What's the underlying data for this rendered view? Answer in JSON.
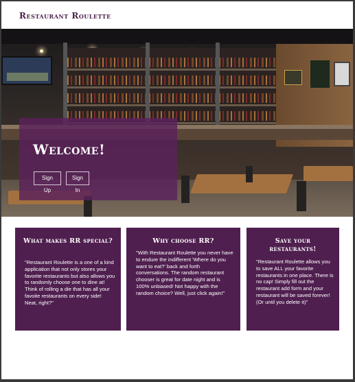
{
  "navbar": {
    "brand": "Restaurant Roulette"
  },
  "hero": {
    "welcome_title": "Welcome!",
    "signup_label": "Sign Up",
    "signin_label": "Sign In"
  },
  "cards": [
    {
      "title": "What makes RR special?",
      "body": "\"Restaurant Roulette is a one of a kind application that not only stores your favorite restaurants but also allows you to randomly choose one to dine at! Think of rolling a die that has all your favoite restaurants on every side! Neat, right?\""
    },
    {
      "title": "Why choose RR?",
      "body": "\"With Restaurant Roulette you never have to endure the indifferent 'Where do you want to eat?' back and forth conversations. The random restaurant chooser is great for date night and is 100% unbiased! Not happy with the random choice? Well, just click again!\""
    },
    {
      "title": "Save your restaurants!",
      "body": "\"Restaurant Roulette allows you to save ALL your favorite restaurants in one place. There is no cap! Simply fill out the restaurant add form and your restaurant will be saved forever! (Or until you delete it)\""
    }
  ],
  "colors": {
    "brand_purple": "#4a1f4a",
    "card_purple": "#4f1f4f",
    "overlay_purple": "#5c215c"
  }
}
